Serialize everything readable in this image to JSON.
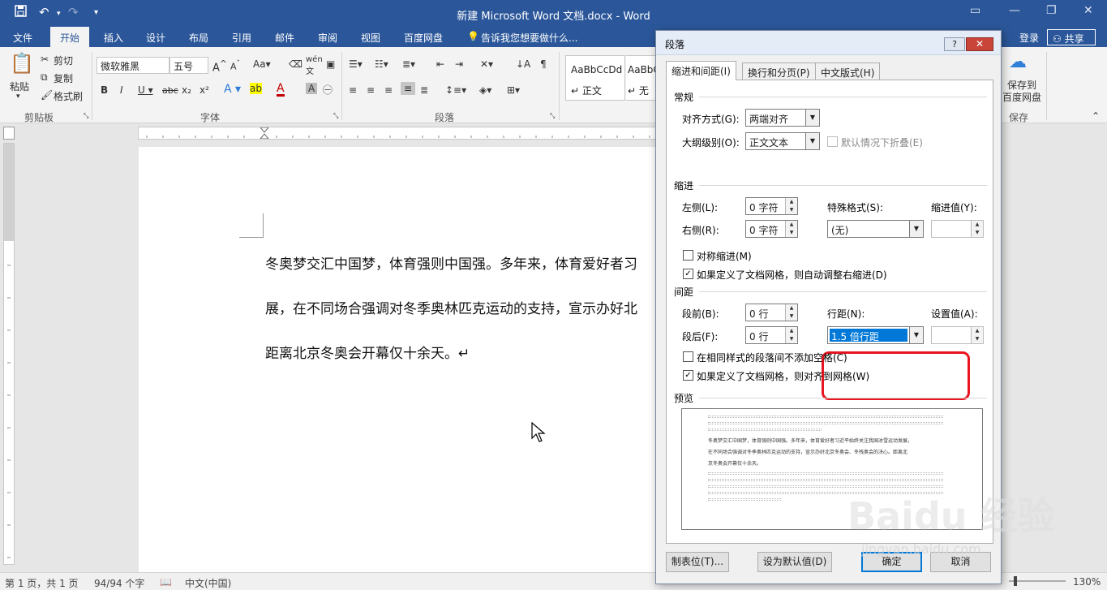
{
  "window": {
    "title": "新建 Microsoft Word 文档.docx - Word",
    "quick_access": {
      "save_icon": "save-icon",
      "undo_icon": "undo-icon",
      "redo_icon": "redo-icon",
      "customize": "▾"
    }
  },
  "ribbon_tabs": [
    "文件",
    "开始",
    "插入",
    "设计",
    "布局",
    "引用",
    "邮件",
    "审阅",
    "视图",
    "百度网盘"
  ],
  "tell_me": "告诉我您想要做什么...",
  "login": "登录",
  "share": "共享",
  "clipboard": {
    "paste": "粘贴",
    "cut": "剪切",
    "copy": "复制",
    "format_painter": "格式刷",
    "group": "剪贴板"
  },
  "font": {
    "name": "微软雅黑",
    "size": "五号",
    "group": "字体"
  },
  "paragraph_group": "段落",
  "styles": [
    {
      "preview": "AaBbCcDd",
      "label": "↵ 正文"
    },
    {
      "preview": "AaBbC",
      "label": "↵ 无间"
    }
  ],
  "baidu": {
    "save_label": "保存到\n百度网盘",
    "group": "保存"
  },
  "document": {
    "lines": [
      "冬奥梦交汇中国梦，体育强则中国强。多年来，体育爱好者习",
      "展，在不同场合强调对冬季奥林匹克运动的支持，宣示办好北",
      "距离北京冬奥会开幕仅十余天。↵"
    ]
  },
  "statusbar": {
    "page": "第 1 页，共 1 页",
    "words": "94/94 个字",
    "language": "中文(中国)",
    "zoom": "130%"
  },
  "dialog": {
    "title": "段落",
    "help": "?",
    "tabs": [
      "缩进和间距(I)",
      "换行和分页(P)",
      "中文版式(H)"
    ],
    "general": {
      "section": "常规",
      "alignment_label": "对齐方式(G):",
      "alignment_value": "两端对齐",
      "outline_label": "大纲级别(O):",
      "outline_value": "正文文本",
      "collapse_label": "默认情况下折叠(E)"
    },
    "indent": {
      "section": "缩进",
      "left_label": "左侧(L):",
      "left_value": "0 字符",
      "right_label": "右侧(R):",
      "right_value": "0 字符",
      "special_label": "特殊格式(S):",
      "special_value": "(无)",
      "by_label": "缩进值(Y):",
      "mirror_label": "对称缩进(M)",
      "auto_adjust_label": "如果定义了文档网格，则自动调整右缩进(D)"
    },
    "spacing": {
      "section": "间距",
      "before_label": "段前(B):",
      "before_value": "0 行",
      "after_label": "段后(F):",
      "after_value": "0 行",
      "line_label": "行距(N):",
      "line_value": "1.5 倍行距",
      "at_label": "设置值(A):",
      "no_space_label": "在相同样式的段落间不添加空格(C)",
      "snap_grid_label": "如果定义了文档网格，则对齐到网格(W)"
    },
    "preview": {
      "section": "预览",
      "text_lines": [
        "冬奥梦交汇中国梦，体育强则中国强。多年来，体育爱好者习近平始终关注我国冰雪运动发展，",
        "在不同场合强调对冬季奥林匹克运动的支持，宣示办好北京冬奥会、冬残奥会的决心。距离北",
        "京冬奥会开幕仅十余天。"
      ]
    },
    "buttons": {
      "tabs": "制表位(T)...",
      "default": "设为默认值(D)",
      "ok": "确定",
      "cancel": "取消"
    }
  },
  "watermark": {
    "logo": "Baidu 经验",
    "url": "jingyan.baidu.com"
  }
}
